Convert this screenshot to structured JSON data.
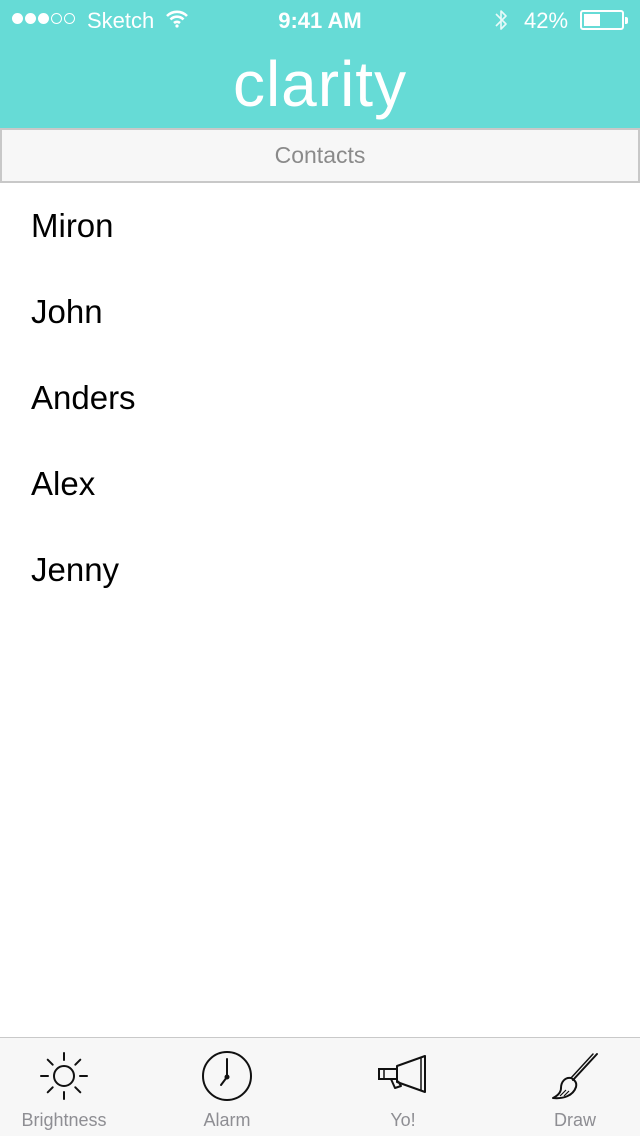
{
  "status_bar": {
    "signal_dots_filled": 3,
    "signal_dots_total": 5,
    "carrier": "Sketch",
    "time": "9:41 AM",
    "battery_percent": "42%",
    "icons": [
      "wifi-icon",
      "bluetooth-icon",
      "battery-icon"
    ]
  },
  "header": {
    "title": "clarity",
    "background_color": "#66dbd6"
  },
  "section": {
    "title": "Contacts"
  },
  "contacts": [
    {
      "name": "Miron"
    },
    {
      "name": "John"
    },
    {
      "name": "Anders"
    },
    {
      "name": "Alex"
    },
    {
      "name": "Jenny"
    }
  ],
  "tab_bar": {
    "tabs": [
      {
        "label": "Brightness",
        "icon": "sun-icon"
      },
      {
        "label": "Alarm",
        "icon": "clock-icon"
      },
      {
        "label": "Yo!",
        "icon": "megaphone-icon"
      },
      {
        "label": "Draw",
        "icon": "paintbrush-icon"
      }
    ]
  }
}
